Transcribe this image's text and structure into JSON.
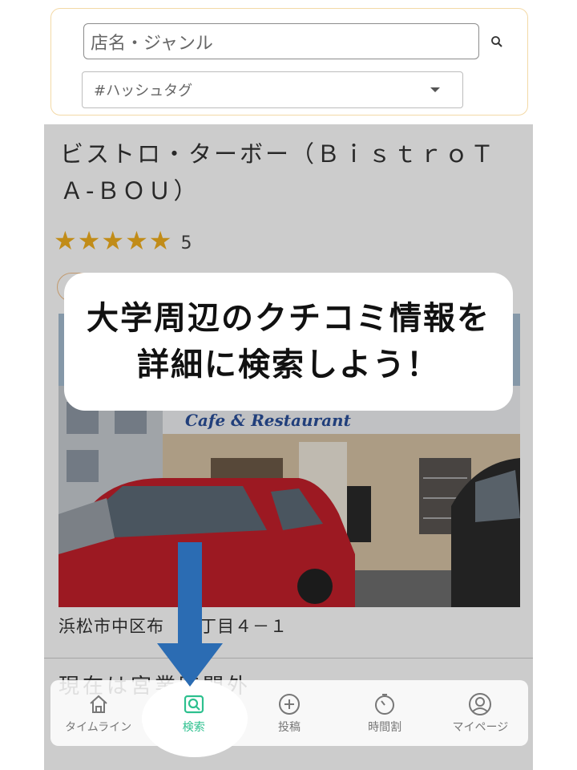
{
  "search": {
    "placeholder": "店名・ジャンル",
    "tag_placeholder": "#ハッシュタグ"
  },
  "store": {
    "name": "ビストロ・ターボー（ＢｉｓｔｒｏＴＡ-ＢＯＵ）",
    "rating": "5",
    "stars_filled": 5,
    "sign_text": "Cafe & Restaurant",
    "address": "浜松市中区布　２丁目４－１",
    "status": "現在は宮業時間外"
  },
  "callout": {
    "line1": "大学周辺のクチコミ情報を",
    "line2": "詳細に検索しよう！"
  },
  "nav": {
    "timeline": "タイムライン",
    "search": "検索",
    "post": "投稿",
    "timetable": "時間割",
    "mypage": "マイページ"
  },
  "colors": {
    "accent": "#2dc08e",
    "star": "#f2b01e",
    "arrow": "#2b6cb3",
    "search_border": "#f3d9a6"
  }
}
